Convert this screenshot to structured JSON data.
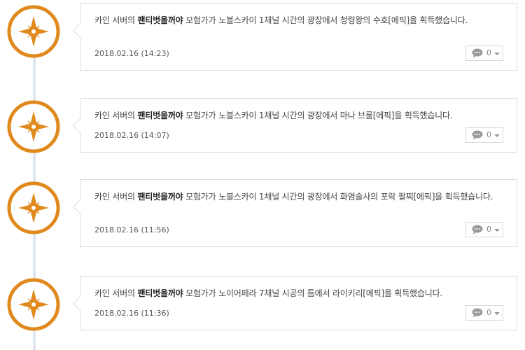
{
  "entries": [
    {
      "server": "카인 서버의",
      "character": "팬티벗을꺼야",
      "message": "모험가가 노블스카이 1채널 시간의 광장에서 청령왕의 수호[에픽]을 획득했습니다.",
      "date": "2018.02.16 (14:23)",
      "comment_count": "0"
    },
    {
      "server": "카인 서버의",
      "character": "팬티벗을꺼야",
      "message": "모험가가 노블스카이 1채널 시간의 광장에서 마나 브룸[에픽]을 획득했습니다.",
      "date": "2018.02.16 (14:07)",
      "comment_count": "0"
    },
    {
      "server": "카인 서버의",
      "character": "팬티벗을꺼야",
      "message": "모험가가 노블스카이 1채널 시간의 광장에서 화염술사의 포락 팔찌[에픽]을 획득했습니다.",
      "date": "2018.02.16 (11:56)",
      "comment_count": "0"
    },
    {
      "server": "카인 서버의",
      "character": "팬티벗을꺼야",
      "message": "모험가가 노이어페라 7채널 시공의 틈에서 라이키리[에픽]을 획득했습니다.",
      "date": "2018.02.16 (11:36)",
      "comment_count": "0"
    }
  ],
  "colors": {
    "accent": "#e08a1e",
    "timeline": "#dfe6f3",
    "border": "#dcdcdc"
  },
  "icons": {
    "badge": "epic-star-icon",
    "comment": "comment-bubble-icon",
    "dropdown": "chevron-down-icon"
  }
}
